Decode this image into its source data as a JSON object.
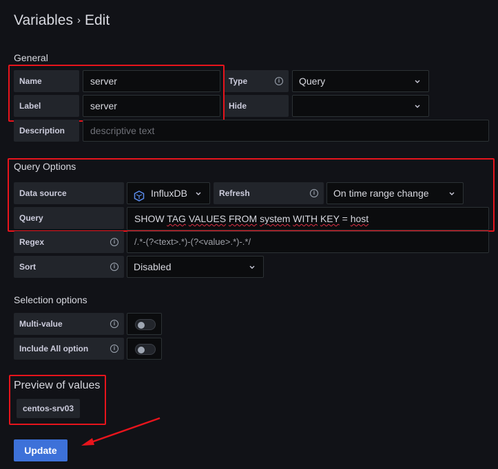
{
  "page": {
    "breadcrumb_parent": "Variables",
    "breadcrumb_separator": "›",
    "breadcrumb_current": "Edit"
  },
  "general": {
    "heading": "General",
    "name_label": "Name",
    "name_value": "server",
    "type_label": "Type",
    "type_value": "Query",
    "label_label": "Label",
    "label_value": "server",
    "hide_label": "Hide",
    "hide_value": "",
    "description_label": "Description",
    "description_placeholder": "descriptive text"
  },
  "query_options": {
    "heading": "Query Options",
    "datasource_label": "Data source",
    "datasource_value": "InfluxDB",
    "refresh_label": "Refresh",
    "refresh_value": "On time range change",
    "query_label": "Query",
    "query_words": [
      "SHOW",
      "TAG",
      "VALUES",
      "FROM",
      "system",
      "WITH",
      "KEY",
      "=",
      "host"
    ],
    "regex_label": "Regex",
    "regex_value": "/.*-(?<text>.*)-(?<value>.*)-.*/",
    "sort_label": "Sort",
    "sort_value": "Disabled"
  },
  "selection_options": {
    "heading": "Selection options",
    "multi_value_label": "Multi-value",
    "multi_value_enabled": false,
    "include_all_label": "Include All option",
    "include_all_enabled": false
  },
  "preview": {
    "heading": "Preview of values",
    "values": [
      "centos-srv03"
    ]
  },
  "actions": {
    "update_label": "Update"
  },
  "colors": {
    "background": "#111217",
    "highlight_box": "#e8141c",
    "primary_button": "#3d71d9"
  },
  "icons": {
    "info": "info-circle-icon",
    "chevron": "chevron-down-icon",
    "datasource": "influxdb-logo-icon",
    "annotation": "red-arrow-annotation"
  }
}
